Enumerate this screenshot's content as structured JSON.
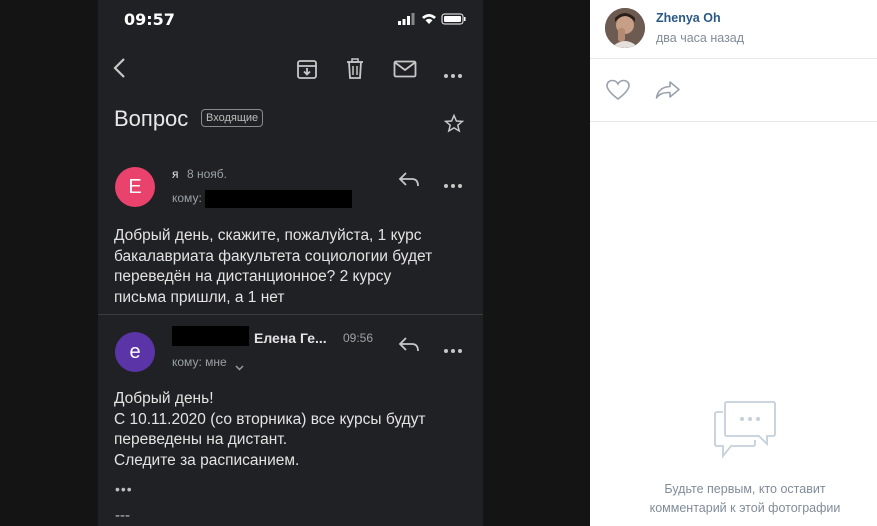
{
  "phone": {
    "status_time": "09:57",
    "subject": "Вопрос",
    "folder_badge": "Входящие",
    "messages": [
      {
        "avatar_letter": "Е",
        "avatar_color": "#e8426d",
        "sender": "я",
        "date": "8 нояб.",
        "to_label": "кому:",
        "body_lines": [
          "Добрый день, скажите, пожалуйста, 1 курс",
          "бакалавриата факультета социологии будет",
          "переведён на дистанционное? 2 курсу",
          "письма пришли, а 1 нет"
        ]
      },
      {
        "avatar_letter": "е",
        "avatar_color": "#5b35a8",
        "sender": "Елена Ге...",
        "time": "09:56",
        "to_label": "кому: мне",
        "body_lines": [
          "Добрый день!",
          "С 10.11.2020 (со вторника) все курсы будут",
          "переведены на дистант.",
          "Следите за расписанием."
        ],
        "more_dots": "•••",
        "signature_sep": "---"
      }
    ]
  },
  "panel": {
    "author": "Zhenya Oh",
    "posted": "два часа назад",
    "empty_line1": "Будьте первым, кто оставит",
    "empty_line2": "комментарий к этой фотографии",
    "accent_color": "#2a5885"
  }
}
